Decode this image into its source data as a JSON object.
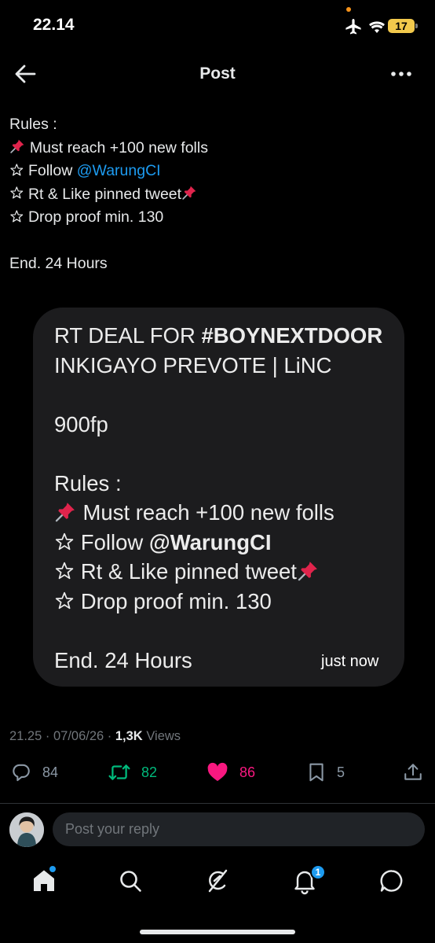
{
  "status_bar": {
    "time": "22.14",
    "battery": "17"
  },
  "header": {
    "title": "Post"
  },
  "post": {
    "rules_heading": "Rules :",
    "rule1": "Must reach +100 new folls",
    "rule2_prefix": "Follow ",
    "rule2_mention": "@WarungCI",
    "rule3": "Rt & Like pinned tweet",
    "rule4": "Drop proof min. 130",
    "end": "End. 24 Hours"
  },
  "card": {
    "line1_prefix": "RT DEAL FOR ",
    "line1_bold": "#BOYNEXTDOOR",
    "line2": "INKIGAYO PREVOTE | LiNC",
    "fp": "900fp",
    "rules_heading": "Rules :",
    "rule1": "Must reach +100 new folls",
    "rule2_prefix": "Follow ",
    "rule2_mention": "@WarungCI",
    "rule3": "Rt & Like pinned tweet",
    "rule4": "Drop proof min. 130",
    "end": "End. 24 Hours",
    "time": "just now"
  },
  "meta": {
    "time": "21.25",
    "date": "07/06/26",
    "views_count": "1,3K",
    "views_label": "Views"
  },
  "actions": {
    "replies": "84",
    "reposts": "82",
    "likes": "86",
    "bookmarks": "5"
  },
  "reply_box": {
    "placeholder": "Post your reply"
  },
  "nav": {
    "notifications_badge": "1"
  },
  "colors": {
    "accent": "#1d9bf0",
    "repost": "#00ba7c",
    "like": "#f91880",
    "background": "#000000"
  },
  "icons": [
    "back-arrow-icon",
    "more-icon",
    "pushpin-icon",
    "star-icon",
    "reply-icon",
    "repost-icon",
    "heart-icon",
    "bookmark-icon",
    "share-icon",
    "home-icon",
    "search-icon",
    "grok-icon",
    "bell-icon",
    "messages-icon"
  ]
}
